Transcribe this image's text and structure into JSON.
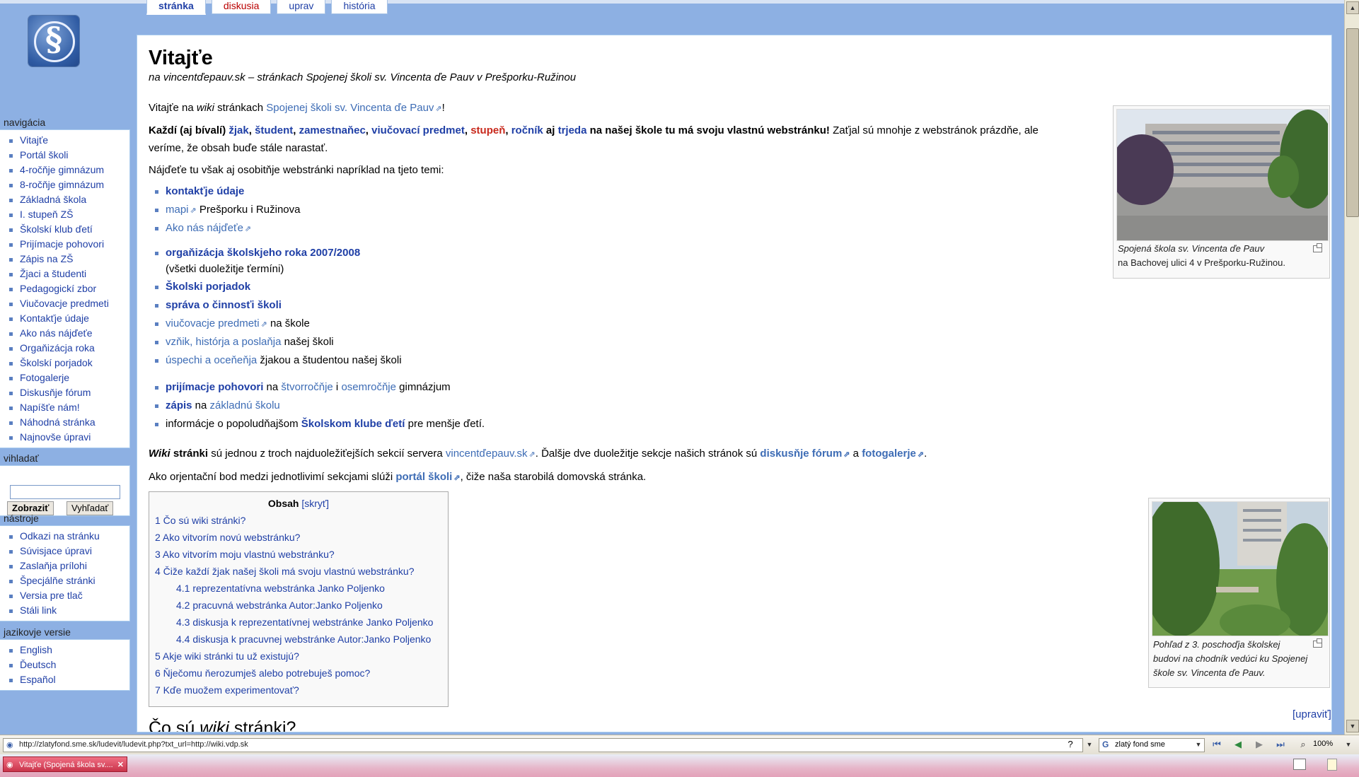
{
  "tabs": {
    "page": "stránka",
    "discussion": "diskusia",
    "edit": "uprav",
    "history": "história"
  },
  "sidebar": {
    "nav_title": "navigácia",
    "nav_items": [
      "Vitajťe",
      "Portál školi",
      "4-ročňje gimnázum",
      "8-ročňje gimnázum",
      "Základná škola",
      "I. stupeň ZŠ",
      "Školskí klub ďetí",
      "Prijímacje pohovori",
      "Zápis na ZŠ",
      "Žjaci a študenti",
      "Pedagogickí zbor",
      "Viučovacje predmeti",
      "Kontakťje údaje",
      "Ako nás nájďeťe",
      "Orgaňizácja roka",
      "Školskí porjadok",
      "Fotogalerje",
      "Diskusňje fórum",
      "Napíšťe nám!",
      "Náhodná stránka",
      "Najnovše úpravi"
    ],
    "search_title": "vihladať",
    "go_button": "Zobraziť",
    "search_button": "Vyhľadať",
    "tools_title": "nástroje",
    "tools_items": [
      "Odkazi na stránku",
      "Súvisjace úpravi",
      "Zaslaňja prílohi",
      "Špecjálňe stránki",
      "Versia pre tlač",
      "Stáli link"
    ],
    "lang_title": "jazikovje versie",
    "lang_items": [
      "English",
      "Ďeutsch",
      "Español"
    ]
  },
  "content": {
    "heading": "Vitajťe",
    "subtitle": "na vincentďepauv.sk – stránkach Spojenej školi sv. Vincenta ďe Pauv v Prešporku-Ružinou",
    "p1_prefix": "Vitajťe na ",
    "p1_wiki": "wiki",
    "p1_mid": " stránkach ",
    "p1_link": "Spojenej školi sv. Vincenta ďe Pauv",
    "p1_end": "!",
    "p2": {
      "a": "Každí (aj bívalí) ",
      "zjak": "žjak",
      "c1": ", ",
      "student": "študent",
      "c2": ", ",
      "zam": "zamestnaňec",
      "c3": ", ",
      "viuc": "viučovací predmet",
      "c4": ", ",
      "stupen": "stupeň",
      "c5": ", ",
      "rocnik": "ročník",
      "aj": " aj ",
      "trieda": "trjeda",
      "b": " na našej škole tu má svoju vlastnú webstránku!",
      "rest1": " Zaťjal sú mnohje z webstránok prázdňe, ale",
      "rest2": "veríme, že obsah buďe stále narastať."
    },
    "p3": "Nájďeťe tu však aj osobitňje webstránki napríklad na tjeto temi:",
    "list1": [
      {
        "link": "kontakťje údaje",
        "text": ""
      },
      {
        "link": "mapi",
        "text": " Prešporku i Ružinova"
      },
      {
        "link": "Ako nás nájďeťe",
        "text": ""
      }
    ],
    "list2_1_link": "orgaňizácja školskjeho roka 2007/2008",
    "list2_1_sub": "(všetki duoležitje ťermíni)",
    "list2_2": "Školski porjadok",
    "list2_3": "správa o činnosťi školi",
    "list2_4_link": "viučovacje predmeti",
    "list2_4_text": " na škole",
    "list2_5_link": "vzňik, histórja a poslaňja",
    "list2_5_text": " našej školi",
    "list2_6_link": "úspechi a oceňeňja",
    "list2_6_text": " žjakou a študentou našej školi",
    "list3_1_link": "prijímacje pohovori",
    "list3_1_mid": " na ",
    "list3_1_l2": "štvorročňje",
    "list3_1_i": " i ",
    "list3_1_l3": "osemročňje",
    "list3_1_end": " gimnázjum",
    "list3_2_link": "zápis",
    "list3_2_mid": " na ",
    "list3_2_l2": "základnú školu",
    "list3_3_text": "informácje o popoludňajšom ",
    "list3_3_link": "Školskom klube ďetí",
    "list3_3_end": " pre menšje ďetí.",
    "p4": {
      "wiki": "Wiki",
      "stranki": " stránki",
      "a": " sú jednou z troch najduoležiťejších sekcií servera ",
      "site": "vincentďepauv.sk",
      "b": ". Ďalšje dve duoležitje sekcje našich stránok sú ",
      "forum": "diskusňje fórum",
      "and": " a ",
      "gallery": "fotogalerje",
      "end": "."
    },
    "p5": {
      "a": "Ako orjentační bod medzi jednotlivimí sekcjami slúži ",
      "portal": "portál školi",
      "b": ", čiže naša starobilá domovská stránka."
    },
    "thumb1_caption_1": "Spojená škola sv. Vincenta ďe Pauv",
    "thumb1_caption_2": "na Bachovej ulici 4 v Prešporku-Ružinou.",
    "thumb2_caption_1": "Pohľad z 3. poschoďja školskej",
    "thumb2_caption_2": "budovi na chodník vedúci ku Spojenej",
    "thumb2_caption_3": "škole sv. Vincenta ďe Pauv.",
    "toc": {
      "title": "Obsah",
      "toggle": "[skryť]",
      "items": [
        {
          "text": "1 Čo sú wiki stránki?",
          "level": 1
        },
        {
          "text": "2 Ako vitvorím novú webstránku?",
          "level": 1
        },
        {
          "text": "3 Ako vitvorím moju vlastnú webstránku?",
          "level": 1
        },
        {
          "text": "4 Čiže každí žjak našej školi má svoju vlastnú webstránku?",
          "level": 1
        },
        {
          "text": "4.1 reprezentatívna webstránka Janko Poljenko",
          "level": 2
        },
        {
          "text": "4.2 pracuvná webstránka Autor:Janko Poljenko",
          "level": 2
        },
        {
          "text": "4.3 diskusja k reprezentatívnej webstránke Janko Poljenko",
          "level": 2
        },
        {
          "text": "4.4 diskusja k pracuvnej webstránke Autor:Janko Poljenko",
          "level": 2
        },
        {
          "text": "5 Akje wiki stránki tu už existujú?",
          "level": 1
        },
        {
          "text": "6 Ňječomu ňerozumješ alebo potrebuješ pomoc?",
          "level": 1
        },
        {
          "text": "7 Kďe muožem experimentovať?",
          "level": 1
        }
      ]
    },
    "edit_link": "[upraviť]",
    "section_heading_1": "Čo sú ",
    "section_heading_wiki": "wiki",
    "section_heading_2": " stránki?"
  },
  "statusbar": {
    "url": "http://zlatyfond.sme.sk/ludevit/ludevit.php?txt_url=http://wiki.vdp.sk",
    "search_engine": "zlatý fond sme",
    "zoom": "100%"
  },
  "taskbar": {
    "item": "Vitajťe (Spojená škola sv...."
  },
  "colors": {
    "link": "#1f3fa6",
    "red_link": "#c8291c",
    "sidebar_bg": "#8db0e3"
  }
}
